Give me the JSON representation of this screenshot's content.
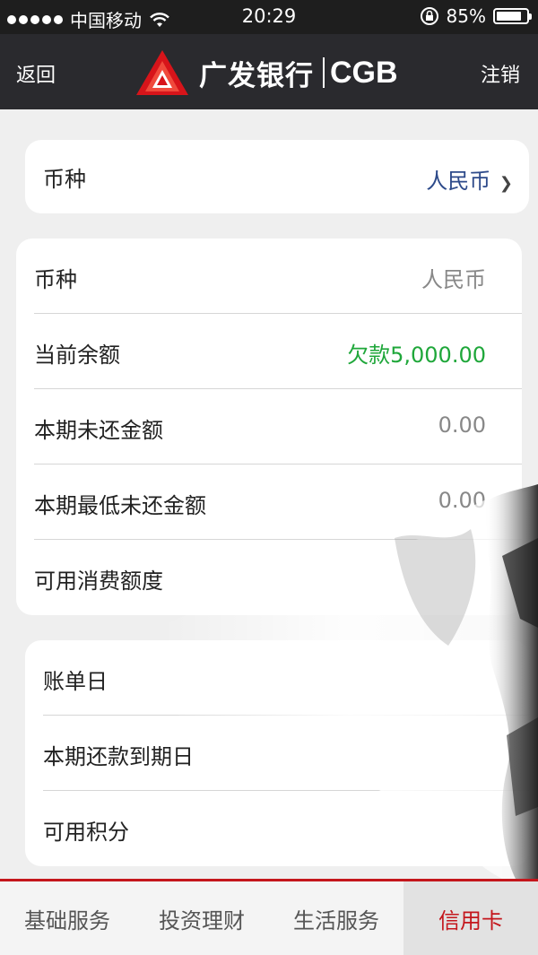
{
  "status_bar": {
    "carrier": "中国移动",
    "time": "20:29",
    "battery_text": "85%",
    "battery_level": 0.85
  },
  "header": {
    "back_label": "返回",
    "logout_label": "注销",
    "brand_cn": "广发银行",
    "brand_en": "CGB"
  },
  "currency_selector": {
    "label": "币种",
    "value": "人民币",
    "chevron": "❯"
  },
  "balance_card": {
    "rows": [
      {
        "label": "币种",
        "value": "人民币"
      },
      {
        "label": "当前余额",
        "value": "欠款5,000.00"
      },
      {
        "label": "本期未还金额",
        "value": "0.00"
      },
      {
        "label": "本期最低未还金额",
        "value": "0.00"
      },
      {
        "label": "可用消费额度",
        "value": ""
      }
    ]
  },
  "bill_card": {
    "rows": [
      {
        "label": "账单日"
      },
      {
        "label": "本期还款到期日"
      },
      {
        "label": "可用积分"
      }
    ]
  },
  "tabs": [
    {
      "label": "基础服务"
    },
    {
      "label": "投资理财"
    },
    {
      "label": "生活服务"
    },
    {
      "label": "信用卡"
    }
  ],
  "colors": {
    "accent_red": "#c4161c",
    "positive_green": "#1fa73a",
    "link_blue": "#2d4a8a"
  },
  "icons": {
    "back": "none",
    "wifi": "wifi-icon",
    "lock": "rotation-lock-icon",
    "battery": "battery-icon"
  }
}
